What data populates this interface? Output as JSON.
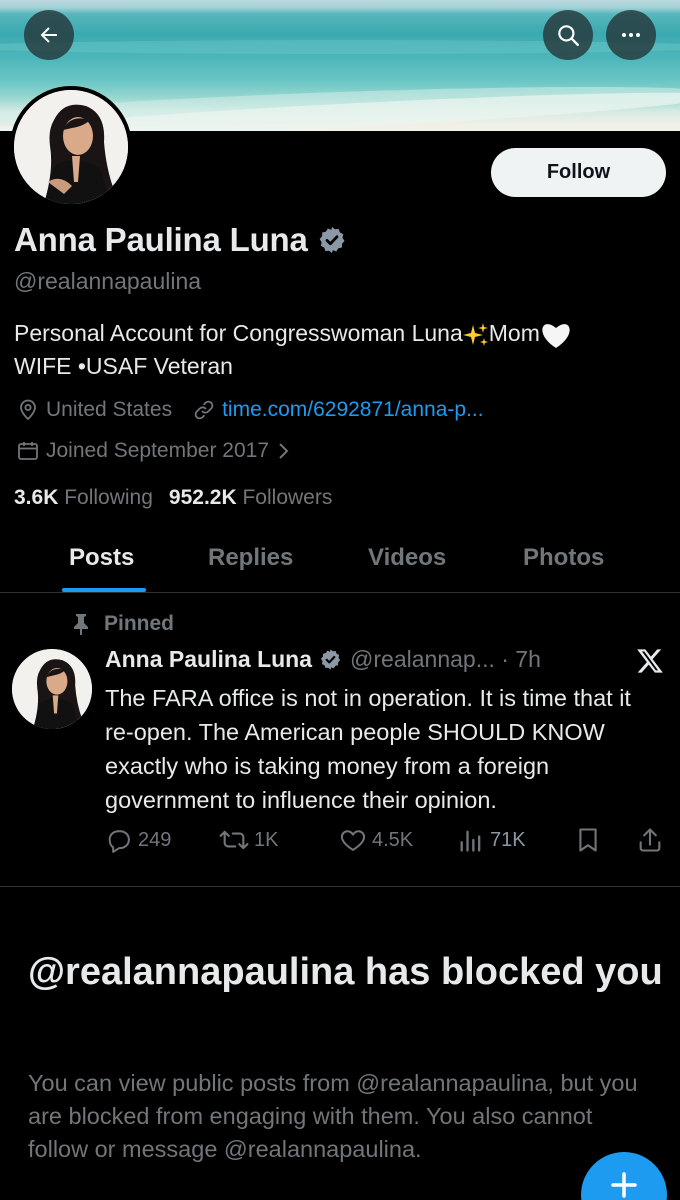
{
  "profile": {
    "display_name": "Anna Paulina Luna",
    "handle": "@realannapaulina",
    "follow_label": "Follow",
    "bio_line1": "Personal Account for Congresswoman Luna",
    "bio_mom": "Mom",
    "bio_line2": "WIFE •USAF Veteran",
    "location": "United States",
    "link": "time.com/6292871/anna-p...",
    "joined": "Joined September 2017",
    "following_count": "3.6K",
    "following_label": "Following",
    "followers_count": "952.2K",
    "followers_label": "Followers"
  },
  "tabs": [
    {
      "label": "Posts",
      "active": true
    },
    {
      "label": "Replies",
      "active": false
    },
    {
      "label": "Videos",
      "active": false
    },
    {
      "label": "Photos",
      "active": false
    }
  ],
  "pinned_tweet": {
    "pinned_label": "Pinned",
    "author": "Anna Paulina Luna",
    "handle_time": "@realannap... · 7h",
    "text": "The FARA office is not in operation.  It is time that it re-open. The American people SHOULD KNOW exactly who is taking money from a foreign government to influence their opinion.",
    "replies": "249",
    "reposts": "1K",
    "likes": "4.5K",
    "views": "71K"
  },
  "blocked": {
    "title": "@realannapaulina has blocked you",
    "body": "You can view public posts from @realannapaulina, but you are blocked from engaging with them. You also cannot follow or message @realannapaulina."
  },
  "colors": {
    "accent": "#1d9bf0",
    "muted": "#71767b",
    "text": "#e7e9ea",
    "background": "#000000"
  },
  "icons": [
    "back-arrow-icon",
    "search-icon",
    "more-icon",
    "verified-badge-icon",
    "location-icon",
    "link-icon",
    "calendar-icon",
    "chevron-right-icon",
    "pin-icon",
    "x-logo-icon",
    "reply-icon",
    "repost-icon",
    "like-icon",
    "views-icon",
    "bookmark-icon",
    "share-icon",
    "plus-icon"
  ]
}
